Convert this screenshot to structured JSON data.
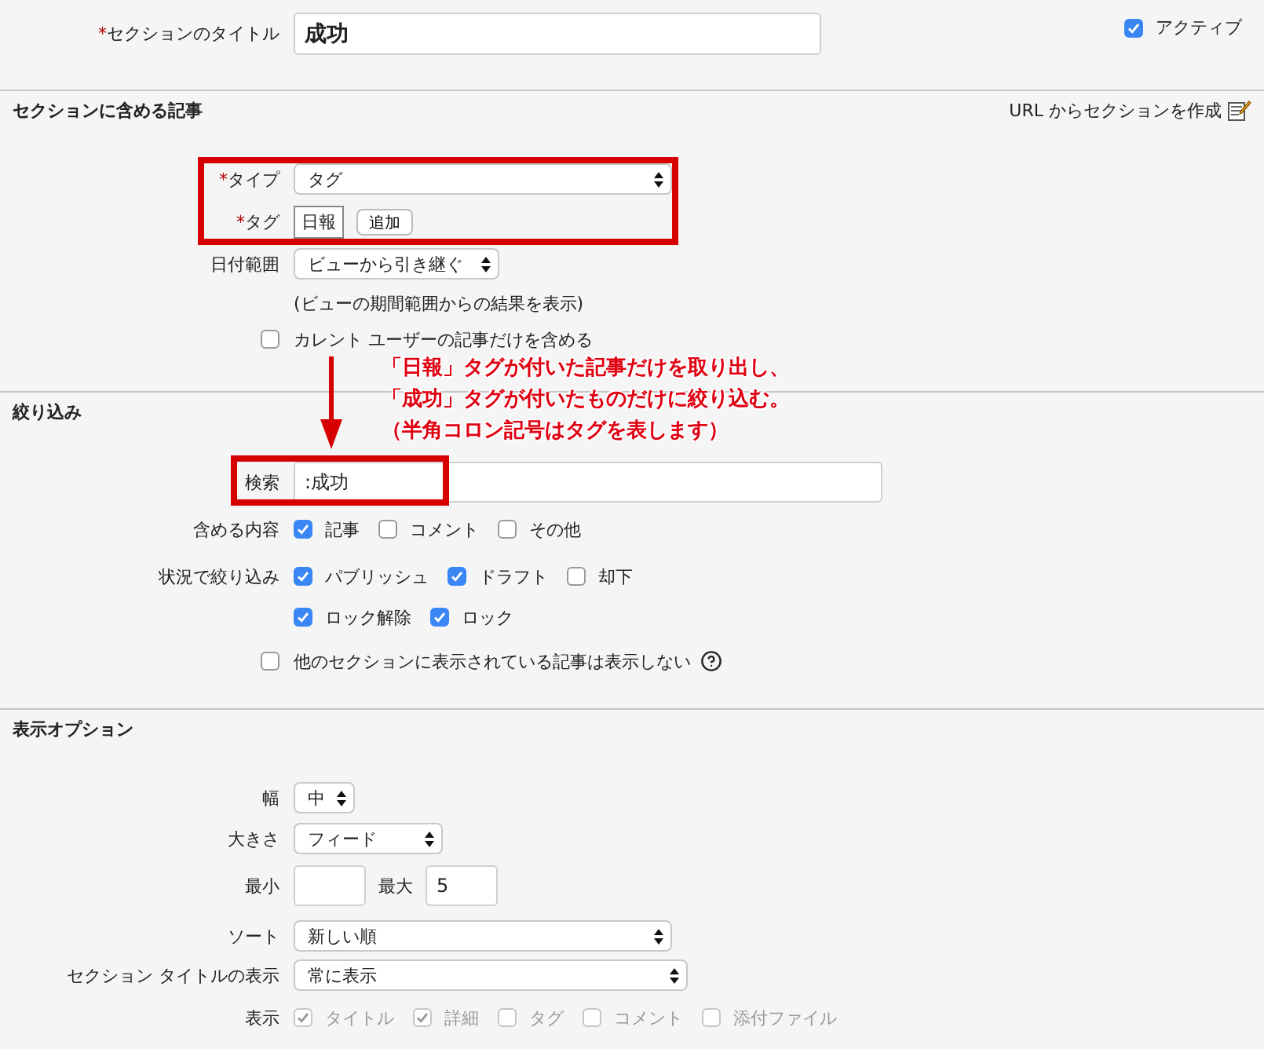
{
  "title_field": {
    "marker": "*",
    "label": "セクションのタイトル",
    "value": "成功"
  },
  "active": {
    "label": "アクティブ",
    "checked": true
  },
  "articles": {
    "heading": "セクションに含める記事",
    "link": "URL からセクションを作成",
    "type": {
      "marker": "*",
      "label": "タイプ",
      "value": "タグ"
    },
    "tag": {
      "marker": "*",
      "label": "タグ",
      "tags": [
        "日報"
      ],
      "button": "追加"
    },
    "date_range": {
      "label": "日付範囲",
      "value": "ビューから引き継ぐ",
      "note": "(ビューの期間範囲からの結果を表示)"
    },
    "current_user": {
      "label": "カレント ユーザーの記事だけを含める",
      "checked": false
    }
  },
  "filter": {
    "heading": "絞り込み",
    "search": {
      "label": "検索",
      "value": ":成功"
    },
    "include": {
      "label": "含める内容",
      "options": [
        {
          "label": "記事",
          "checked": true
        },
        {
          "label": "コメント",
          "checked": false
        },
        {
          "label": "その他",
          "checked": false
        }
      ]
    },
    "status": {
      "label": "状況で絞り込み",
      "lines": [
        {
          "options": [
            {
              "label": "パブリッシュ",
              "checked": true
            },
            {
              "label": "ドラフト",
              "checked": true
            },
            {
              "label": "却下",
              "checked": false
            }
          ]
        },
        {
          "options": [
            {
              "label": "ロック解除",
              "checked": true
            },
            {
              "label": "ロック",
              "checked": true
            }
          ]
        }
      ]
    },
    "hide_shown": {
      "label": "他のセクションに表示されている記事は表示しない",
      "checked": false
    }
  },
  "display": {
    "heading": "表示オプション",
    "width": {
      "label": "幅",
      "value": "中"
    },
    "size": {
      "label": "大きさ",
      "value": "フィード"
    },
    "min": {
      "label": "最小"
    },
    "max": {
      "label": "最大",
      "value": "5"
    },
    "sort": {
      "label": "ソート",
      "value": "新しい順"
    },
    "title_display": {
      "label": "セクション タイトルの表示",
      "value": "常に表示"
    },
    "show": {
      "label": "表示",
      "disabled": true,
      "options": [
        {
          "label": "タイトル",
          "checked": true
        },
        {
          "label": "詳細",
          "checked": true
        },
        {
          "label": "タグ",
          "checked": false
        },
        {
          "label": "コメント",
          "checked": false
        },
        {
          "label": "添付ファイル",
          "checked": false
        }
      ]
    }
  },
  "annotation": {
    "lines": [
      "「日報」タグが付いた記事だけを取り出し、",
      "「成功」タグが付いたものだけに絞り込む。",
      "（半角コロン記号はタグを表します）"
    ]
  }
}
